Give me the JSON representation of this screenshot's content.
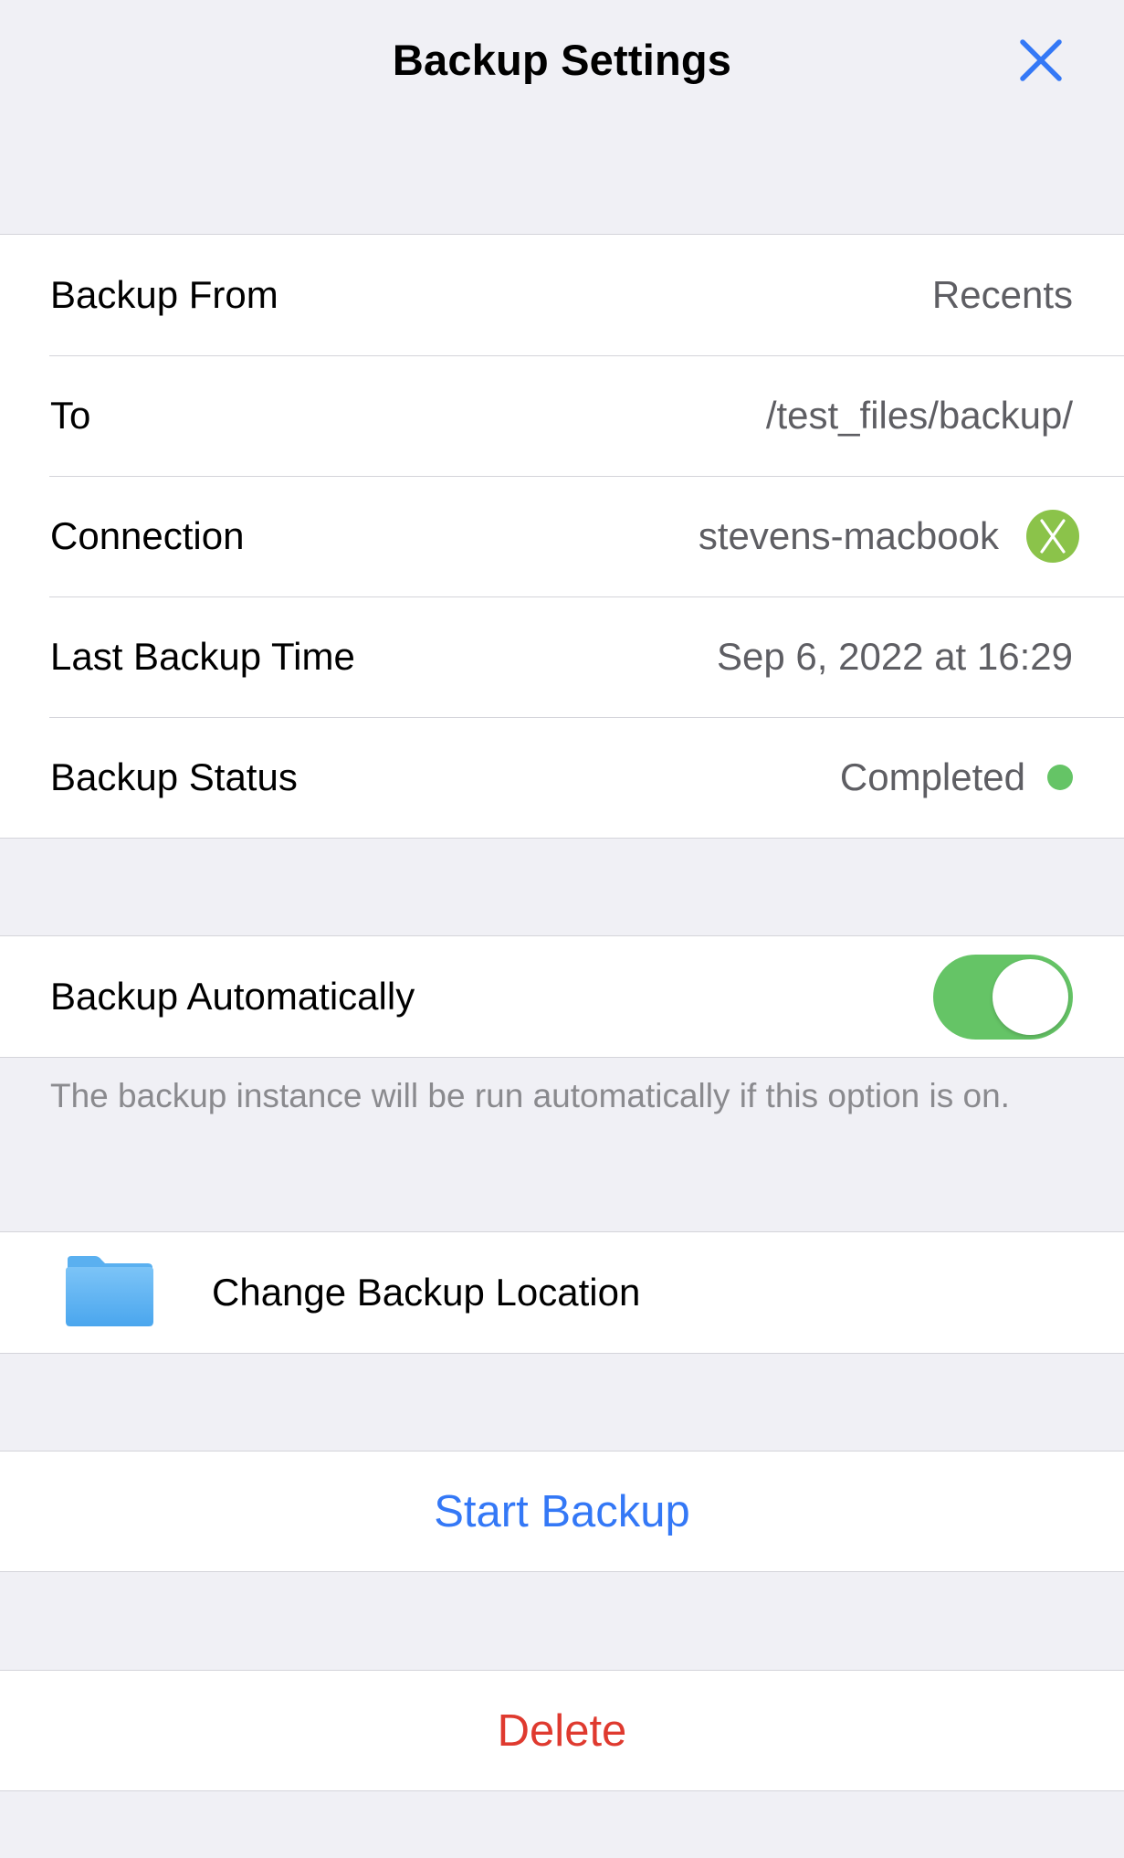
{
  "header": {
    "title": "Backup Settings"
  },
  "info": {
    "backup_from_label": "Backup From",
    "backup_from_value": "Recents",
    "to_label": "To",
    "to_value": "/test_files/backup/",
    "connection_label": "Connection",
    "connection_value": "stevens-macbook",
    "connection_badge_letter": "X",
    "last_backup_label": "Last Backup Time",
    "last_backup_value": "Sep 6, 2022 at 16:29",
    "status_label": "Backup Status",
    "status_value": "Completed",
    "status_color": "#65c466"
  },
  "auto": {
    "label": "Backup Automatically",
    "enabled": true,
    "footnote": "The backup instance will be run automatically if this option is on."
  },
  "location": {
    "label": "Change Backup Location",
    "icon": "folder-icon"
  },
  "actions": {
    "start": "Start Backup",
    "delete": "Delete"
  },
  "colors": {
    "accent": "#3478f6",
    "destructive": "#df3a2f",
    "toggle_on": "#65c466",
    "background": "#f0f0f5"
  }
}
